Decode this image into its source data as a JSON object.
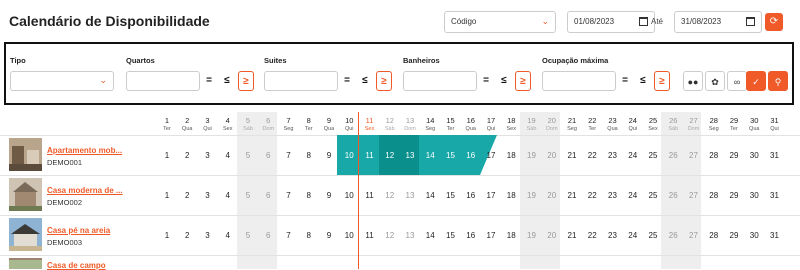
{
  "header": {
    "title": "Calendário de Disponibilidade",
    "sort_select": "Código",
    "date_from": "01/08/2023",
    "date_to_label": "Até",
    "date_to": "31/08/2023"
  },
  "filters": {
    "tipo_label": "Tipo",
    "quartos_label": "Quartos",
    "suites_label": "Suites",
    "banheiros_label": "Banheiros",
    "ocupacao_label": "Ocupação máxima",
    "eq": "=",
    "le": "≤",
    "ge": "≥"
  },
  "days": [
    {
      "n": "1",
      "w": "Ter"
    },
    {
      "n": "2",
      "w": "Qua"
    },
    {
      "n": "3",
      "w": "Qui"
    },
    {
      "n": "4",
      "w": "Sex"
    },
    {
      "n": "5",
      "w": "Sáb"
    },
    {
      "n": "6",
      "w": "Dom"
    },
    {
      "n": "7",
      "w": "Seg"
    },
    {
      "n": "8",
      "w": "Ter"
    },
    {
      "n": "9",
      "w": "Qua"
    },
    {
      "n": "10",
      "w": "Qui"
    },
    {
      "n": "11",
      "w": "Sex"
    },
    {
      "n": "12",
      "w": "Sáb"
    },
    {
      "n": "13",
      "w": "Dom"
    },
    {
      "n": "14",
      "w": "Seg"
    },
    {
      "n": "15",
      "w": "Ter"
    },
    {
      "n": "16",
      "w": "Qua"
    },
    {
      "n": "17",
      "w": "Qui"
    },
    {
      "n": "18",
      "w": "Sex"
    },
    {
      "n": "19",
      "w": "Sáb"
    },
    {
      "n": "20",
      "w": "Dom"
    },
    {
      "n": "21",
      "w": "Seg"
    },
    {
      "n": "22",
      "w": "Ter"
    },
    {
      "n": "23",
      "w": "Qua"
    },
    {
      "n": "24",
      "w": "Qui"
    },
    {
      "n": "25",
      "w": "Sex"
    },
    {
      "n": "26",
      "w": "Sáb"
    },
    {
      "n": "27",
      "w": "Dom"
    },
    {
      "n": "28",
      "w": "Seg"
    },
    {
      "n": "29",
      "w": "Ter"
    },
    {
      "n": "30",
      "w": "Qua"
    },
    {
      "n": "31",
      "w": "Qui"
    }
  ],
  "properties": [
    {
      "name": "Apartamento mob...",
      "code": "DEMO001"
    },
    {
      "name": "Casa moderna de ...",
      "code": "DEMO002"
    },
    {
      "name": "Casa pé na areia",
      "code": "DEMO003"
    },
    {
      "name": "Casa de campo",
      "code": ""
    }
  ],
  "colors": {
    "accent": "#f05a28",
    "teal": "#19a8a8",
    "teal_dark": "#0b8f8c",
    "weekend_band": "#eeeeee"
  }
}
